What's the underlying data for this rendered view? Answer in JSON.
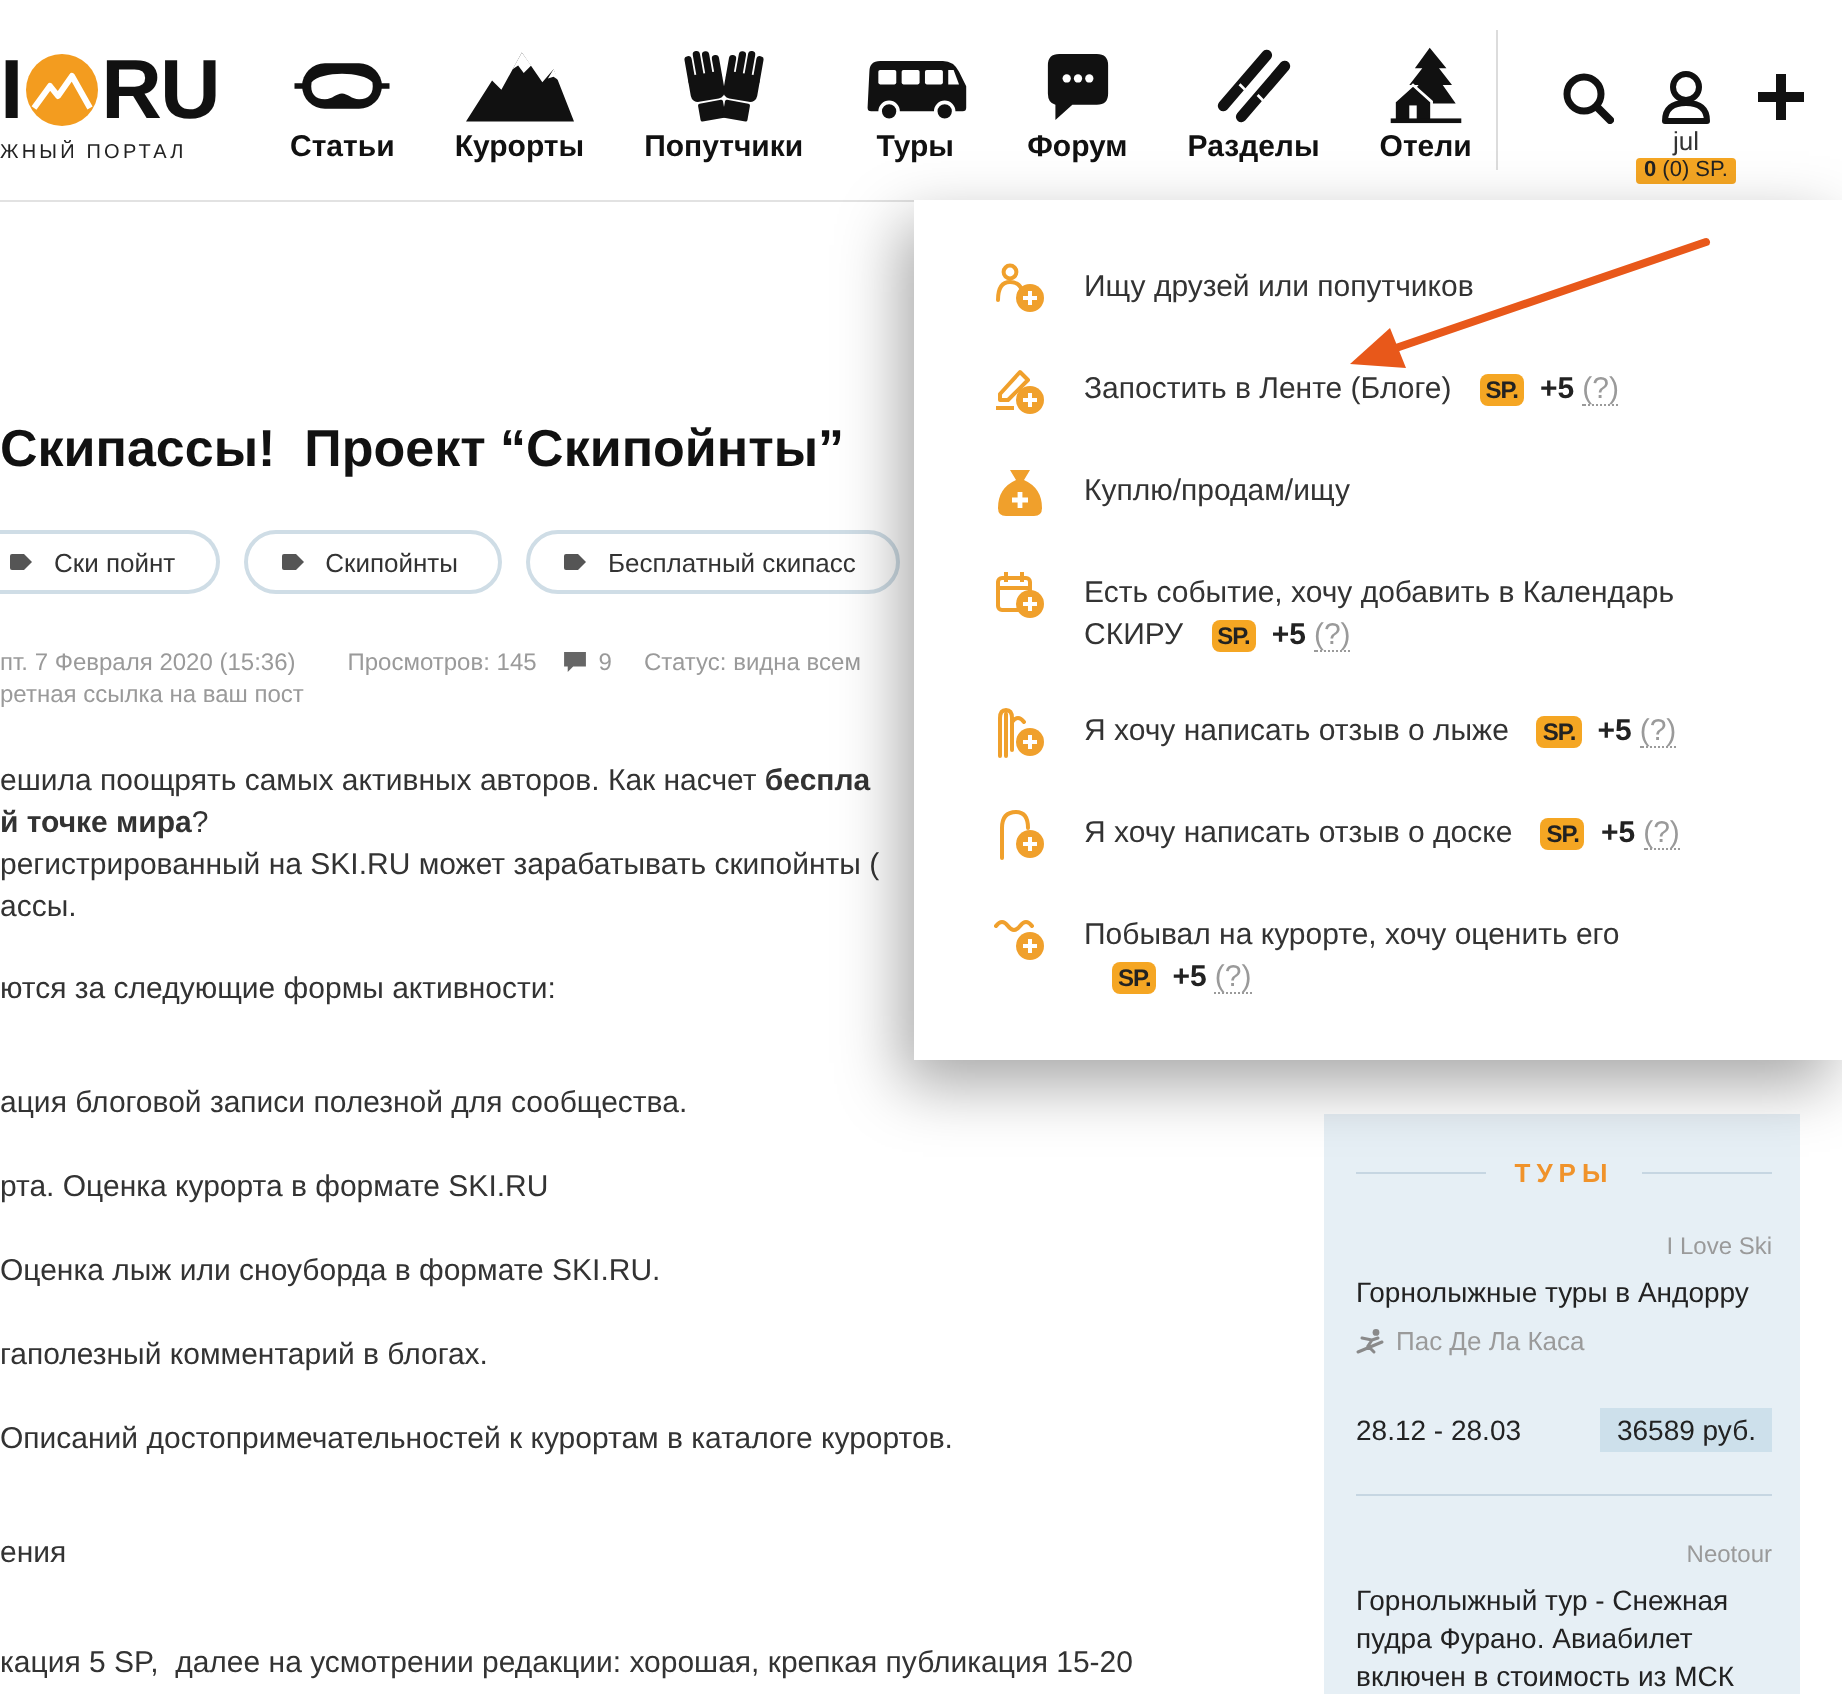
{
  "header": {
    "logo": {
      "left": "I",
      "right": "RU",
      "tagline": "ЖНЫЙ ПОРТАЛ"
    },
    "nav": [
      {
        "label": "Статьи"
      },
      {
        "label": "Курорты"
      },
      {
        "label": "Попутчики"
      },
      {
        "label": "Туры"
      },
      {
        "label": "Форум"
      },
      {
        "label": "Разделы"
      },
      {
        "label": "Отели"
      }
    ],
    "user": {
      "name": "jul",
      "points": "**0** (0) SP."
    }
  },
  "post": {
    "title": "Скипассы!  Проект “Скипойнты”",
    "tags": [
      {
        "label": "Ски пойнт"
      },
      {
        "label": "Скипойнты"
      },
      {
        "label": "Бесплатный скипасс"
      }
    ],
    "meta": {
      "date": "пт. 7 Февраля 2020 (15:36)",
      "views": "Просмотров: 145",
      "comments": "9",
      "status": "Статус: видна всем",
      "note": "ретная ссылка на ваш пост"
    },
    "body": [
      {
        "kind": "paragraph",
        "lines": [
          "ешила поощрять самых активных авторов. Как насчет **беспла**",
          "**й точке мира**?",
          "регистрированный на SKI.RU может зарабатывать скипойнты (",
          "ассы."
        ]
      },
      {
        "kind": "paragraph",
        "lines": [
          "ются за следующие формы активности:"
        ]
      },
      {
        "kind": "list",
        "items": [
          "ация блоговой записи полезной для сообщества.",
          "рта. Оценка курорта в формате SKI.RU",
          "Оценка лыж или сноуборда в формате SKI.RU.",
          "гаполезный комментарий в блогах.",
          "Описаний достопримечательностей к курортам в каталоге курортов."
        ]
      },
      {
        "kind": "heading",
        "lines": [
          "ения"
        ]
      },
      {
        "kind": "paragraph",
        "lines": [
          "кация 5 SP,  далее на усмотрении редакции: хорошая, крепкая публикация 15-20"
        ]
      }
    ]
  },
  "add_menu": {
    "items": [
      {
        "label": "Ищу друзей или попутчиков"
      },
      {
        "label": "Запостить в Ленте (Блоге)",
        "reward": {
          "badge": "SP.",
          "points": "+5",
          "help": "(?)"
        }
      },
      {
        "label": "Куплю/продам/ищу"
      },
      {
        "label": "Есть событие, хочу добавить в Календарь СКИРУ",
        "reward": {
          "badge": "SP.",
          "points": "+5",
          "help": "(?)"
        }
      },
      {
        "label": "Я хочу написать отзыв о лыже",
        "reward": {
          "badge": "SP.",
          "points": "+5",
          "help": "(?)"
        }
      },
      {
        "label": "Я хочу написать отзыв о доске",
        "reward": {
          "badge": "SP.",
          "points": "+5",
          "help": "(?)"
        }
      },
      {
        "label": "Побывал на курорте, хочу оценить его",
        "reward": {
          "badge": "SP.",
          "points": "+5",
          "help": "(?)"
        }
      }
    ]
  },
  "sidebar": {
    "title": "ТУРЫ",
    "tours": [
      {
        "operator": "I Love Ski",
        "title": "Горнолыжные туры в Андорру",
        "location": "Пас Де Ла Каса",
        "dates": "28.12 - 28.03",
        "price": "36589 руб."
      },
      {
        "operator": "Neotour",
        "title": "Горнолыжный тур - Снежная пудра Фурано. Авиабилет включен в стоимость из МСК"
      }
    ]
  }
}
